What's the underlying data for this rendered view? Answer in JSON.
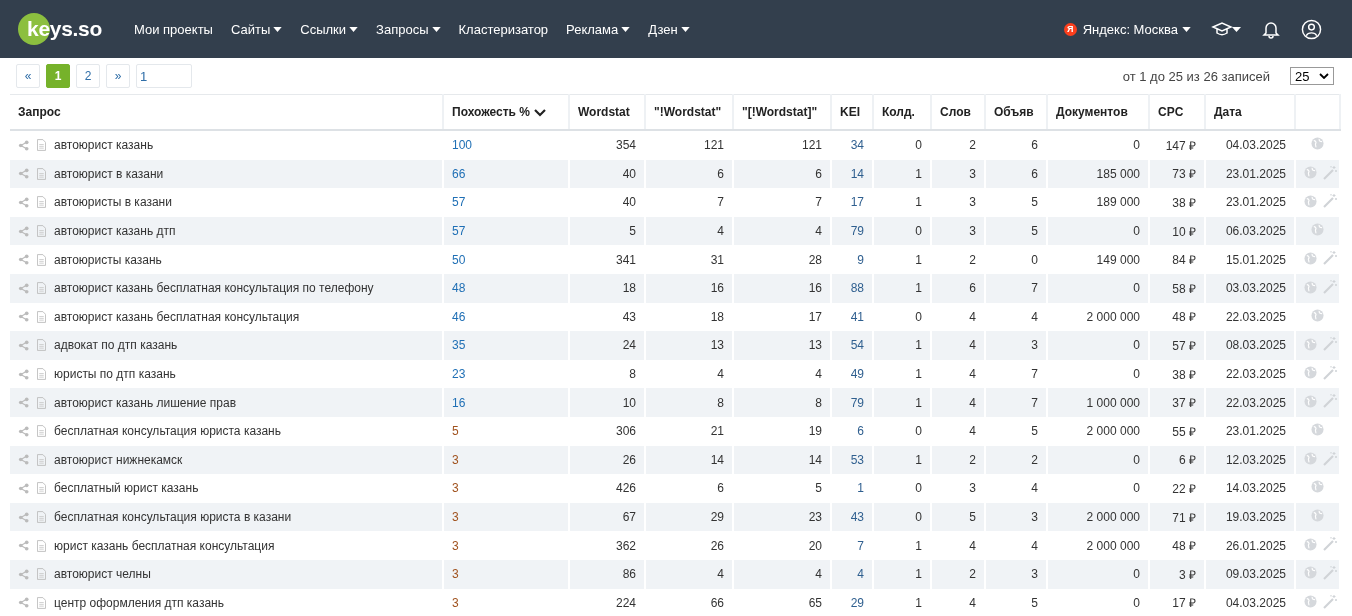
{
  "nav": {
    "logo": "keys.so",
    "items": [
      {
        "label": "Мои проекты",
        "dropdown": false
      },
      {
        "label": "Сайты",
        "dropdown": true
      },
      {
        "label": "Ссылки",
        "dropdown": true
      },
      {
        "label": "Запросы",
        "dropdown": true
      },
      {
        "label": "Кластеризатор",
        "dropdown": false
      },
      {
        "label": "Реклама",
        "dropdown": true
      },
      {
        "label": "Дзен",
        "dropdown": true
      }
    ],
    "region_badge": "Я",
    "region": "Яндекс: Москва"
  },
  "pagination": {
    "prev": "«",
    "pages": [
      {
        "label": "1",
        "selected": true
      },
      {
        "label": "2",
        "selected": false
      }
    ],
    "next": "»",
    "page_input": "1",
    "summary": "от 1 до 25 из 26 записей",
    "page_size": "25"
  },
  "table": {
    "columns": [
      "Запрос",
      "Похожесть %",
      "Wordstat",
      "\"!Wordstat\"",
      "\"[!Wordstat]\"",
      "KEI",
      "Колд.",
      "Слов",
      "Объяв",
      "Документов",
      "CPC",
      "Дата"
    ],
    "rows": [
      {
        "cells": [
          "автоюрист казань",
          "100",
          "354",
          "121",
          "121",
          "34",
          "0",
          "2",
          "6",
          "0",
          "147 ₽",
          "04.03.2025"
        ],
        "color": "#1f6fb5",
        "wand": false
      },
      {
        "cells": [
          "автоюрист в казани",
          "66",
          "40",
          "6",
          "6",
          "14",
          "1",
          "3",
          "6",
          "185 000",
          "73 ₽",
          "23.01.2025"
        ],
        "color": "#1f6fb5",
        "wand": true
      },
      {
        "cells": [
          "автоюристы в казани",
          "57",
          "40",
          "7",
          "7",
          "17",
          "1",
          "3",
          "5",
          "189 000",
          "38 ₽",
          "23.01.2025"
        ],
        "color": "#1f6fb5",
        "wand": true
      },
      {
        "cells": [
          "автоюрист казань дтп",
          "57",
          "5",
          "4",
          "4",
          "79",
          "0",
          "3",
          "5",
          "0",
          "10 ₽",
          "06.03.2025"
        ],
        "color": "#1f6fb5",
        "wand": false
      },
      {
        "cells": [
          "автоюристы казань",
          "50",
          "341",
          "31",
          "28",
          "9",
          "1",
          "2",
          "0",
          "149 000",
          "84 ₽",
          "15.01.2025"
        ],
        "color": "#1f6fb5",
        "wand": true
      },
      {
        "cells": [
          "автоюрист казань бесплатная консультация по телефону",
          "48",
          "18",
          "16",
          "16",
          "88",
          "1",
          "6",
          "7",
          "0",
          "58 ₽",
          "03.03.2025"
        ],
        "color": "#1f6fb5",
        "wand": true
      },
      {
        "cells": [
          "автоюрист казань бесплатная консультация",
          "46",
          "43",
          "18",
          "17",
          "41",
          "0",
          "4",
          "4",
          "2 000 000",
          "48 ₽",
          "22.03.2025"
        ],
        "color": "#1f6fb5",
        "wand": false
      },
      {
        "cells": [
          "адвокат по дтп казань",
          "35",
          "24",
          "13",
          "13",
          "54",
          "1",
          "4",
          "3",
          "0",
          "57 ₽",
          "08.03.2025"
        ],
        "color": "#1f6fb5",
        "wand": true
      },
      {
        "cells": [
          "юристы по дтп казань",
          "23",
          "8",
          "4",
          "4",
          "49",
          "1",
          "4",
          "7",
          "0",
          "38 ₽",
          "22.03.2025"
        ],
        "color": "#1f6fb5",
        "wand": true
      },
      {
        "cells": [
          "автоюрист казань лишение прав",
          "16",
          "10",
          "8",
          "8",
          "79",
          "1",
          "4",
          "7",
          "1 000 000",
          "37 ₽",
          "22.03.2025"
        ],
        "color": "#1f6fb5",
        "wand": true
      },
      {
        "cells": [
          "бесплатная консультация юриста казань",
          "5",
          "306",
          "21",
          "19",
          "6",
          "0",
          "4",
          "5",
          "2 000 000",
          "55 ₽",
          "23.01.2025"
        ],
        "color": "#a0521e",
        "wand": false
      },
      {
        "cells": [
          "автоюрист нижнекамск",
          "3",
          "26",
          "14",
          "14",
          "53",
          "1",
          "2",
          "2",
          "0",
          "6 ₽",
          "12.03.2025"
        ],
        "color": "#a0521e",
        "wand": true
      },
      {
        "cells": [
          "бесплатный юрист казань",
          "3",
          "426",
          "6",
          "5",
          "1",
          "0",
          "3",
          "4",
          "0",
          "22 ₽",
          "14.03.2025"
        ],
        "color": "#a0521e",
        "wand": false
      },
      {
        "cells": [
          "бесплатная консультация юриста в казани",
          "3",
          "67",
          "29",
          "23",
          "43",
          "0",
          "5",
          "3",
          "2 000 000",
          "71 ₽",
          "19.03.2025"
        ],
        "color": "#a0521e",
        "wand": false
      },
      {
        "cells": [
          "юрист казань бесплатная консультация",
          "3",
          "362",
          "26",
          "20",
          "7",
          "1",
          "4",
          "4",
          "2 000 000",
          "48 ₽",
          "26.01.2025"
        ],
        "color": "#a0521e",
        "wand": true
      },
      {
        "cells": [
          "автоюрист челны",
          "3",
          "86",
          "4",
          "4",
          "4",
          "1",
          "2",
          "3",
          "0",
          "3 ₽",
          "09.03.2025"
        ],
        "color": "#a0521e",
        "wand": true
      },
      {
        "cells": [
          "центр оформления дтп казань",
          "3",
          "224",
          "66",
          "65",
          "29",
          "1",
          "4",
          "5",
          "0",
          "17 ₽",
          "04.03.2025"
        ],
        "color": "#a0521e",
        "wand": true
      }
    ]
  }
}
